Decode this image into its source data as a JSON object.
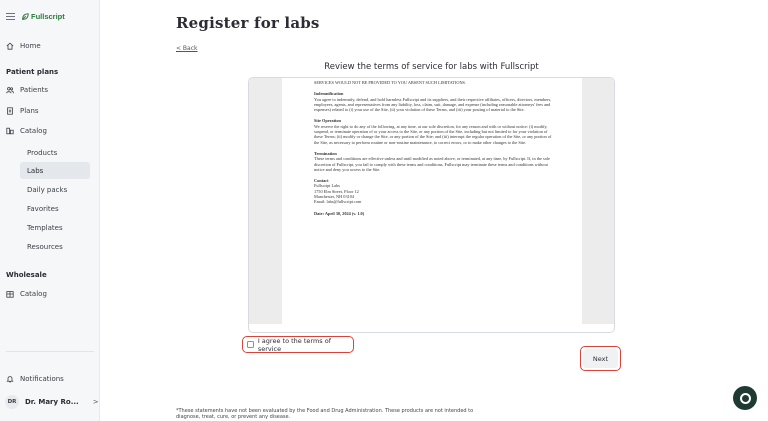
{
  "sidebar": {
    "logo_text": "Fullscript",
    "home": "Home",
    "patient_plans_title": "Patient plans",
    "patients": "Patients",
    "plans": "Plans",
    "catalog": "Catalog",
    "catalog_items": [
      "Products",
      "Labs",
      "Daily packs",
      "Favorites",
      "Templates",
      "Resources"
    ],
    "active_item": "Labs",
    "wholesale_title": "Wholesale",
    "wholesale_catalog": "Catalog",
    "notifications": "Notifications",
    "user_initials": "DR",
    "user_name": "Dr. Mary Ro...",
    "user_chevron": ">"
  },
  "main": {
    "title": "Register for labs",
    "back_label": "< Back",
    "terms_heading": "Review the terms of service for labs with Fullscript",
    "document": {
      "first_line": "SERVICES WOULD NOT BE PROVIDED TO YOU ABSENT SUCH LIMITATIONS.",
      "indemnification_title": "Indemnification",
      "indemnification_text": "You agree to indemnify, defend, and hold harmless Fullscript and its suppliers, and their respective affiliates, officers, directors, members, employees, agents, and representatives from any liability, loss, claim, suit, damage, and expense (including reasonable attorneys' fees and expenses) related to (i) your use of the Site, (ii) your violation of these Terms, and (iii) your posting of material to the Site.",
      "site_operation_title": "Site Operation",
      "site_operation_text": "We reserve the right to do any of the following, at any time, at our sole discretion, for any reason and with or without notice: (i) modify, suspend, or terminate operation of or your access to the Site, or any portion of the Site, including but not limited to for your violation of these Terms; (ii) modify or change the Site, or any portion of the Site; and (iii) interrupt the regular operation of the Site, or any portion of the Site, as necessary to perform routine or non-routine maintenance, to correct errors, or to make other changes to the Site.",
      "termination_title": "Termination",
      "termination_text": "These terms and conditions are effective unless and until modified as noted above, or terminated, at any time, by Fullscript. If, in the sole discretion of Fullscript, you fail to comply with these terms and conditions, Fullscript may terminate these terms and conditions without notice and deny you access to the Site.",
      "contact_title": "Contact",
      "contact_lines": [
        "Fullscript Labs",
        "1750 Elm Street, Floor 12",
        "Manchester, NH 03104",
        "Email: labs@fullscript.com"
      ],
      "date_line": "Date: April 30, 2024 (v. 1.0)"
    },
    "agree_label": "I agree to the terms of service",
    "agree_checked": false,
    "next_label": "Next",
    "disclaimer": "*These statements have not been evaluated by the Food and Drug Administration. These products are not intended to diagnose, treat, cure, or prevent any disease."
  },
  "colors": {
    "highlight_outline": "#d9443a",
    "brand_green": "#2a7a3b",
    "chat_button": "#1f3a32"
  },
  "icons": [
    "menu-icon",
    "leaf-logo-icon",
    "home-icon",
    "patients-icon",
    "plans-icon",
    "catalog-icon",
    "wholesale-catalog-icon",
    "bell-icon",
    "chat-icon"
  ]
}
